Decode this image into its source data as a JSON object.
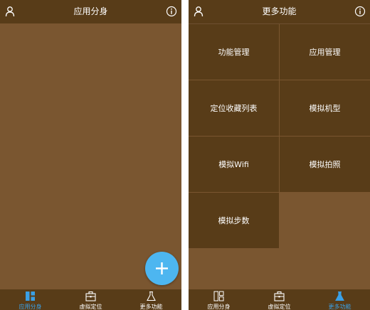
{
  "left_screen": {
    "header": {
      "title": "应用分身",
      "user_icon": "person-icon",
      "info_icon": "info-icon"
    },
    "fab": {
      "icon": "plus-icon"
    },
    "tabs": [
      {
        "label": "应用分身",
        "icon": "grid-icon",
        "active": true
      },
      {
        "label": "虚拟定位",
        "icon": "briefcase-icon",
        "active": false
      },
      {
        "label": "更多功能",
        "icon": "flask-icon",
        "active": false
      }
    ]
  },
  "right_screen": {
    "header": {
      "title": "更多功能",
      "user_icon": "person-icon",
      "info_icon": "info-icon"
    },
    "features": [
      "功能管理",
      "应用管理",
      "定位收藏列表",
      "模拟机型",
      "模拟Wifi",
      "模拟拍照",
      "模拟步数"
    ],
    "tabs": [
      {
        "label": "应用分身",
        "icon": "grid-icon",
        "active": false
      },
      {
        "label": "虚拟定位",
        "icon": "briefcase-icon",
        "active": false
      },
      {
        "label": "更多功能",
        "icon": "flask-icon",
        "active": true
      }
    ]
  },
  "colors": {
    "background": "#7a5630",
    "header": "#583c18",
    "tile": "#583c18",
    "accent": "#3aa0e6",
    "fab": "#4db6f0"
  }
}
